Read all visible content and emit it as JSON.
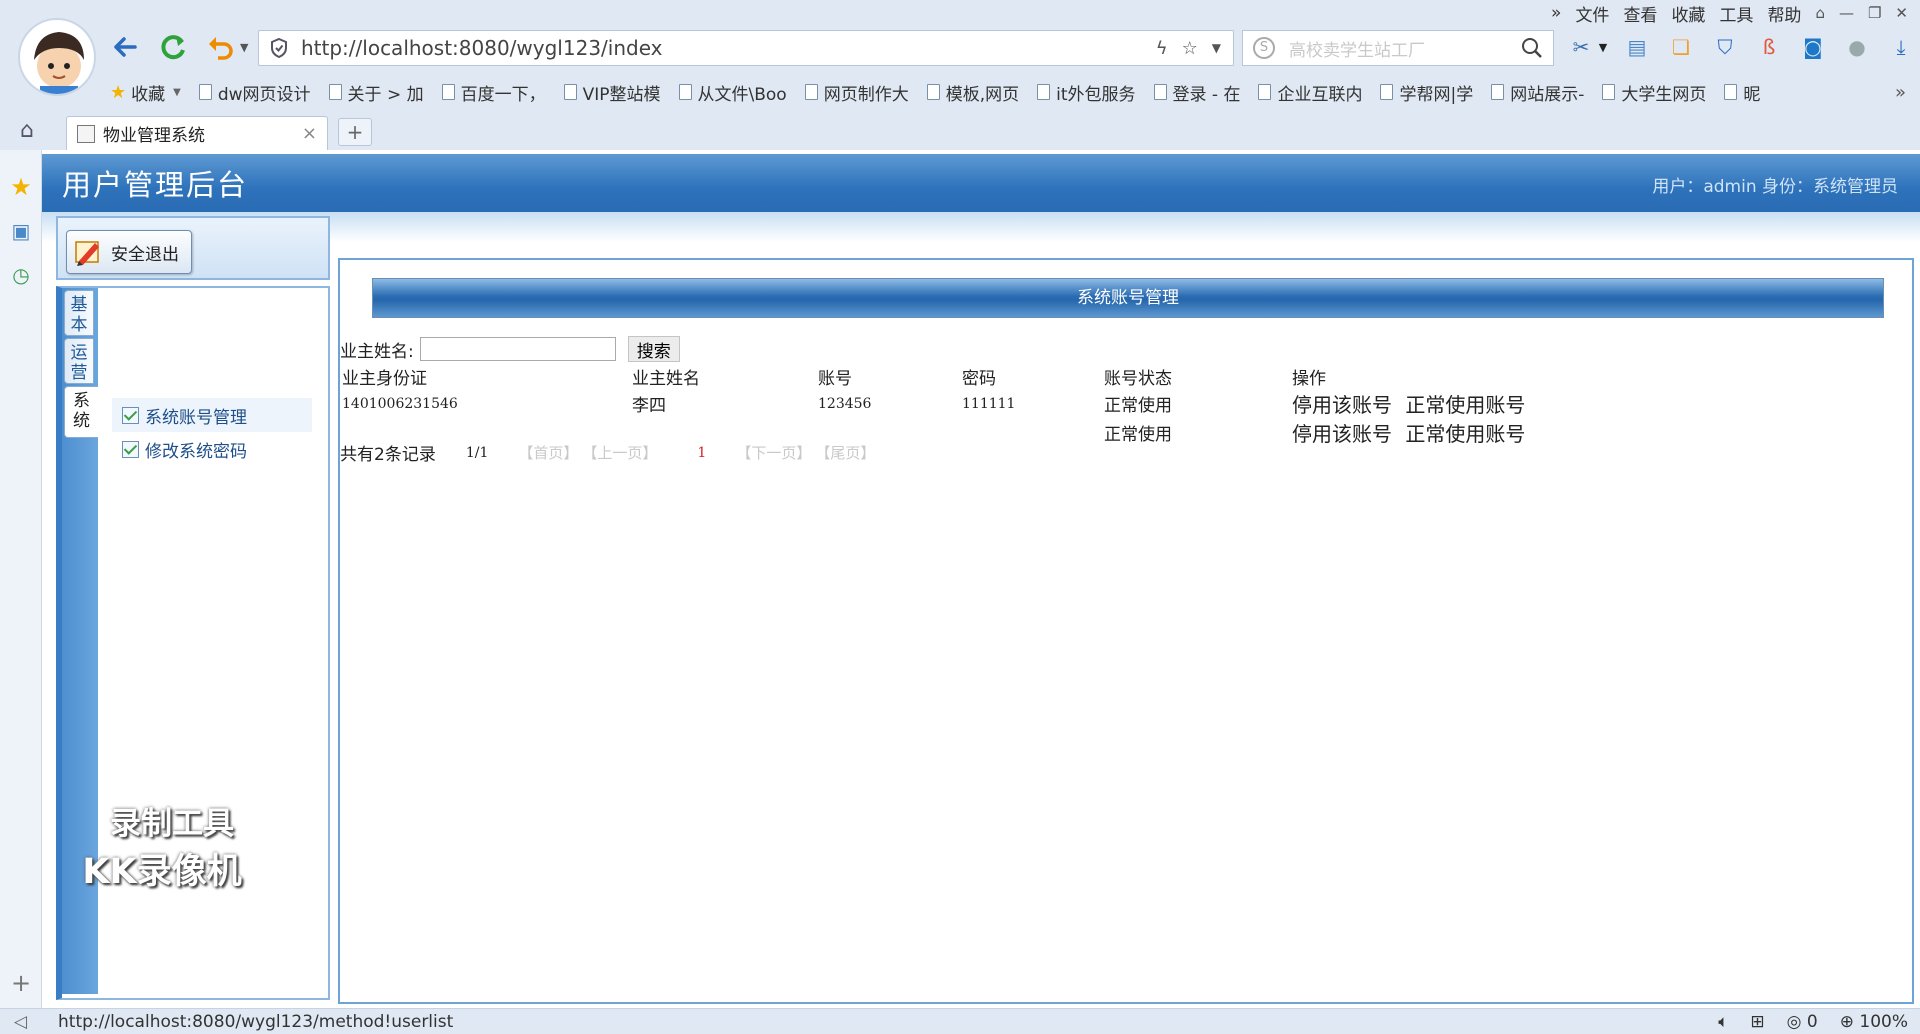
{
  "browser": {
    "menu": [
      "文件",
      "查看",
      "收藏",
      "工具",
      "帮助"
    ],
    "menu_more": "»",
    "address": "http://localhost:8080/wygl123/index",
    "search_placeholder": "高校卖学生站工厂",
    "bookmarks": [
      "收藏",
      "dw网页设计",
      "关于 > 加",
      "百度一下，",
      "VIP整站模",
      "从文件\\Boo",
      "网页制作大",
      "模板,网页",
      "it外包服务",
      "登录 - 在",
      "企业互联内",
      "学帮网|学",
      "网站展示-",
      "大学生网页",
      "昵"
    ],
    "bookmark_more": "»",
    "tab_title": "物业管理系统",
    "tab_close": "×",
    "tab_new": "+",
    "status_url": "http://localhost:8080/wygl123/method!userlist",
    "status_count": "0",
    "zoom": "100%"
  },
  "app": {
    "title": "用户管理后台",
    "user_info": "用户：admin   身份：系统管理员",
    "logout_label": "安全退出",
    "side_tabs": [
      "基本",
      "运营",
      "系统"
    ],
    "menu_items": [
      "系统账号管理",
      "修改系统密码"
    ],
    "watermark_line1": "录制工具",
    "watermark_line2": "KK录像机"
  },
  "main": {
    "section_title": "系统账号管理",
    "search_label": "业主姓名:",
    "search_value": "",
    "search_button": "搜索",
    "columns": [
      "业主身份证",
      "业主姓名",
      "账号",
      "密码",
      "账号状态",
      "操作"
    ],
    "rows": [
      {
        "id_card": "1401006231546",
        "name": "李四",
        "account": "123456",
        "password": "111111",
        "status": "正常使用",
        "action_disable": "停用该账号",
        "action_enable": "正常使用账号"
      },
      {
        "id_card": "",
        "name": "",
        "account": "",
        "password": "",
        "status": "正常使用",
        "action_disable": "停用该账号",
        "action_enable": "正常使用账号"
      }
    ],
    "pager": {
      "total": "共有2条记录",
      "page": "1/1",
      "first": "【首页】",
      "prev": "【上一页】",
      "current": "1",
      "next": "【下一页】",
      "last": "【尾页】"
    }
  },
  "colors": {
    "header_blue": "#2d72bb",
    "page_current": "#d9202a",
    "link_blue": "#1f4f8a"
  }
}
